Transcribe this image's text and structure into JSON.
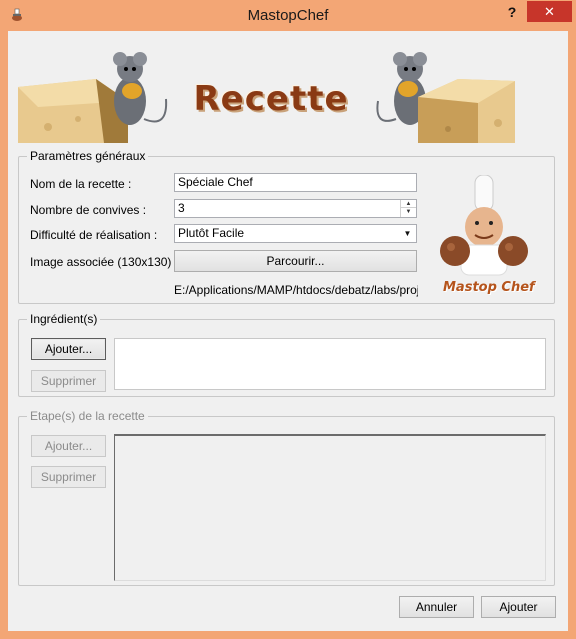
{
  "window": {
    "title": "MastopChef",
    "help": "?",
    "close": "✕"
  },
  "banner": {
    "title": "Recette"
  },
  "general": {
    "group_title": "Paramètres généraux",
    "name_label": "Nom de la recette :",
    "name_value": "Spéciale Chef",
    "guests_label": "Nombre de convives :",
    "guests_value": "3",
    "difficulty_label": "Difficulté de réalisation :",
    "difficulty_value": "Plutôt Facile",
    "image_label": "Image associée (130x130) :",
    "browse_button": "Parcourir...",
    "image_path": "E:/Applications/MAMP/htdocs/debatz/labs/projects/",
    "chef_caption": "Mastop Chef"
  },
  "ingredients": {
    "group_title": "Ingrédient(s)",
    "add_button": "Ajouter...",
    "remove_button": "Supprimer"
  },
  "steps": {
    "group_title": "Etape(s) de la recette",
    "add_button": "Ajouter...",
    "remove_button": "Supprimer"
  },
  "footer": {
    "cancel_button": "Annuler",
    "ok_button": "Ajouter"
  },
  "colors": {
    "frame": "#f3a675",
    "close": "#c7352a",
    "banner_text": "#8a3a14"
  }
}
